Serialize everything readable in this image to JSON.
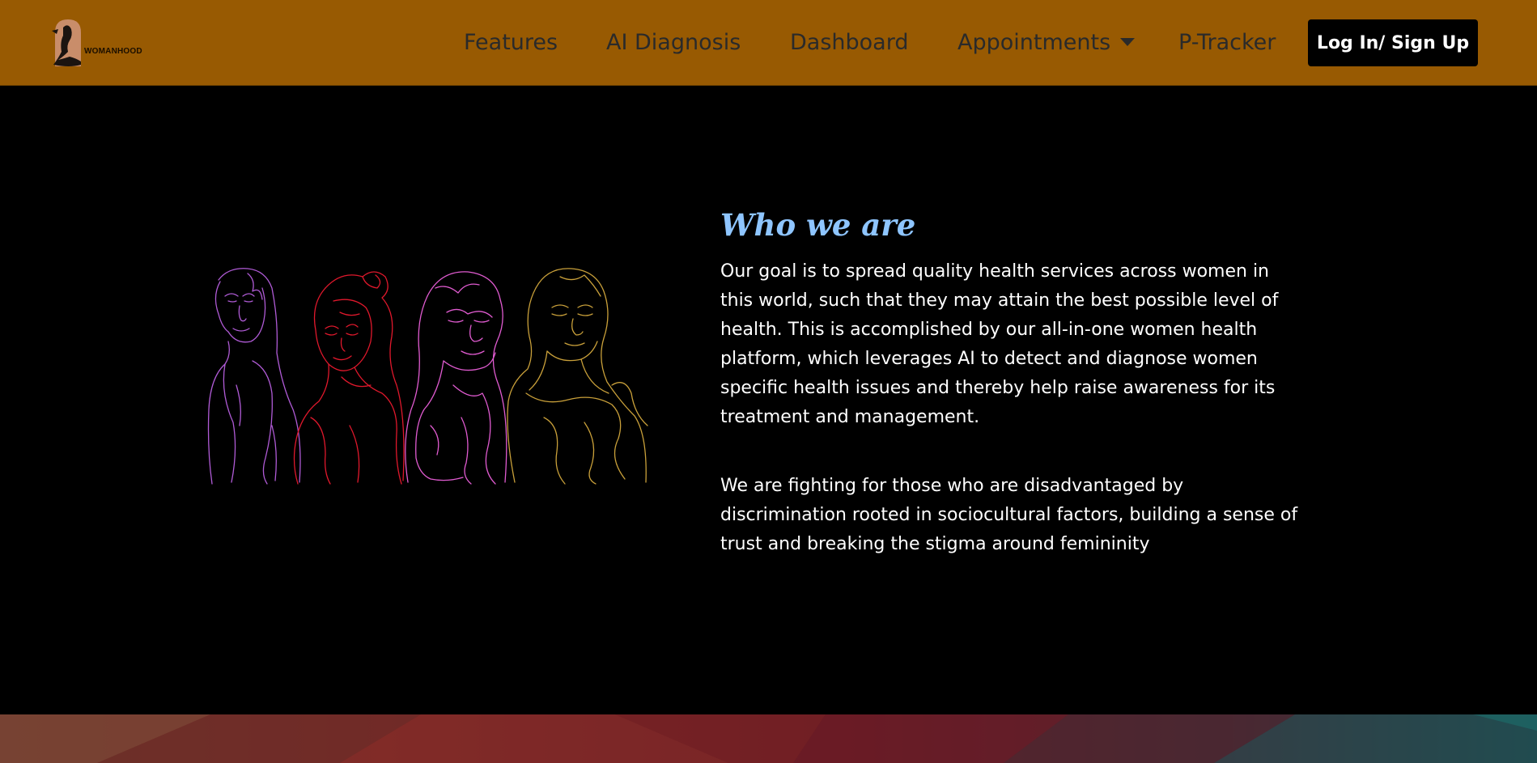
{
  "brand": {
    "logo_text": "WOMANHOOD"
  },
  "nav": {
    "items": [
      {
        "label": "Features"
      },
      {
        "label": "AI Diagnosis"
      },
      {
        "label": "Dashboard"
      },
      {
        "label": "Appointments"
      },
      {
        "label": "P-Tracker"
      }
    ],
    "login_label": "Log In/ Sign Up"
  },
  "about": {
    "title": "Who we are",
    "paragraph_1": "Our goal is to spread quality health services across women in this world, such that they may attain the best possible level of health. This is accomplished by our all-in-one women health platform, which leverages AI to detect and diagnose women specific health issues and thereby help raise awareness for its treatment and management.",
    "paragraph_2": "We are fighting for those who are disadvantaged by discrimination rooted in sociocultural factors, building a sense of trust and breaking the stigma around femininity"
  },
  "colors": {
    "navbar_bg": "#985a02",
    "heading": "#8ec5ff",
    "figure_1": "#b05bd6",
    "figure_2": "#e0182c",
    "figure_3": "#e05bd0",
    "figure_4": "#c9a03a"
  },
  "icons": {
    "dropdown": "chevron-down-icon"
  }
}
